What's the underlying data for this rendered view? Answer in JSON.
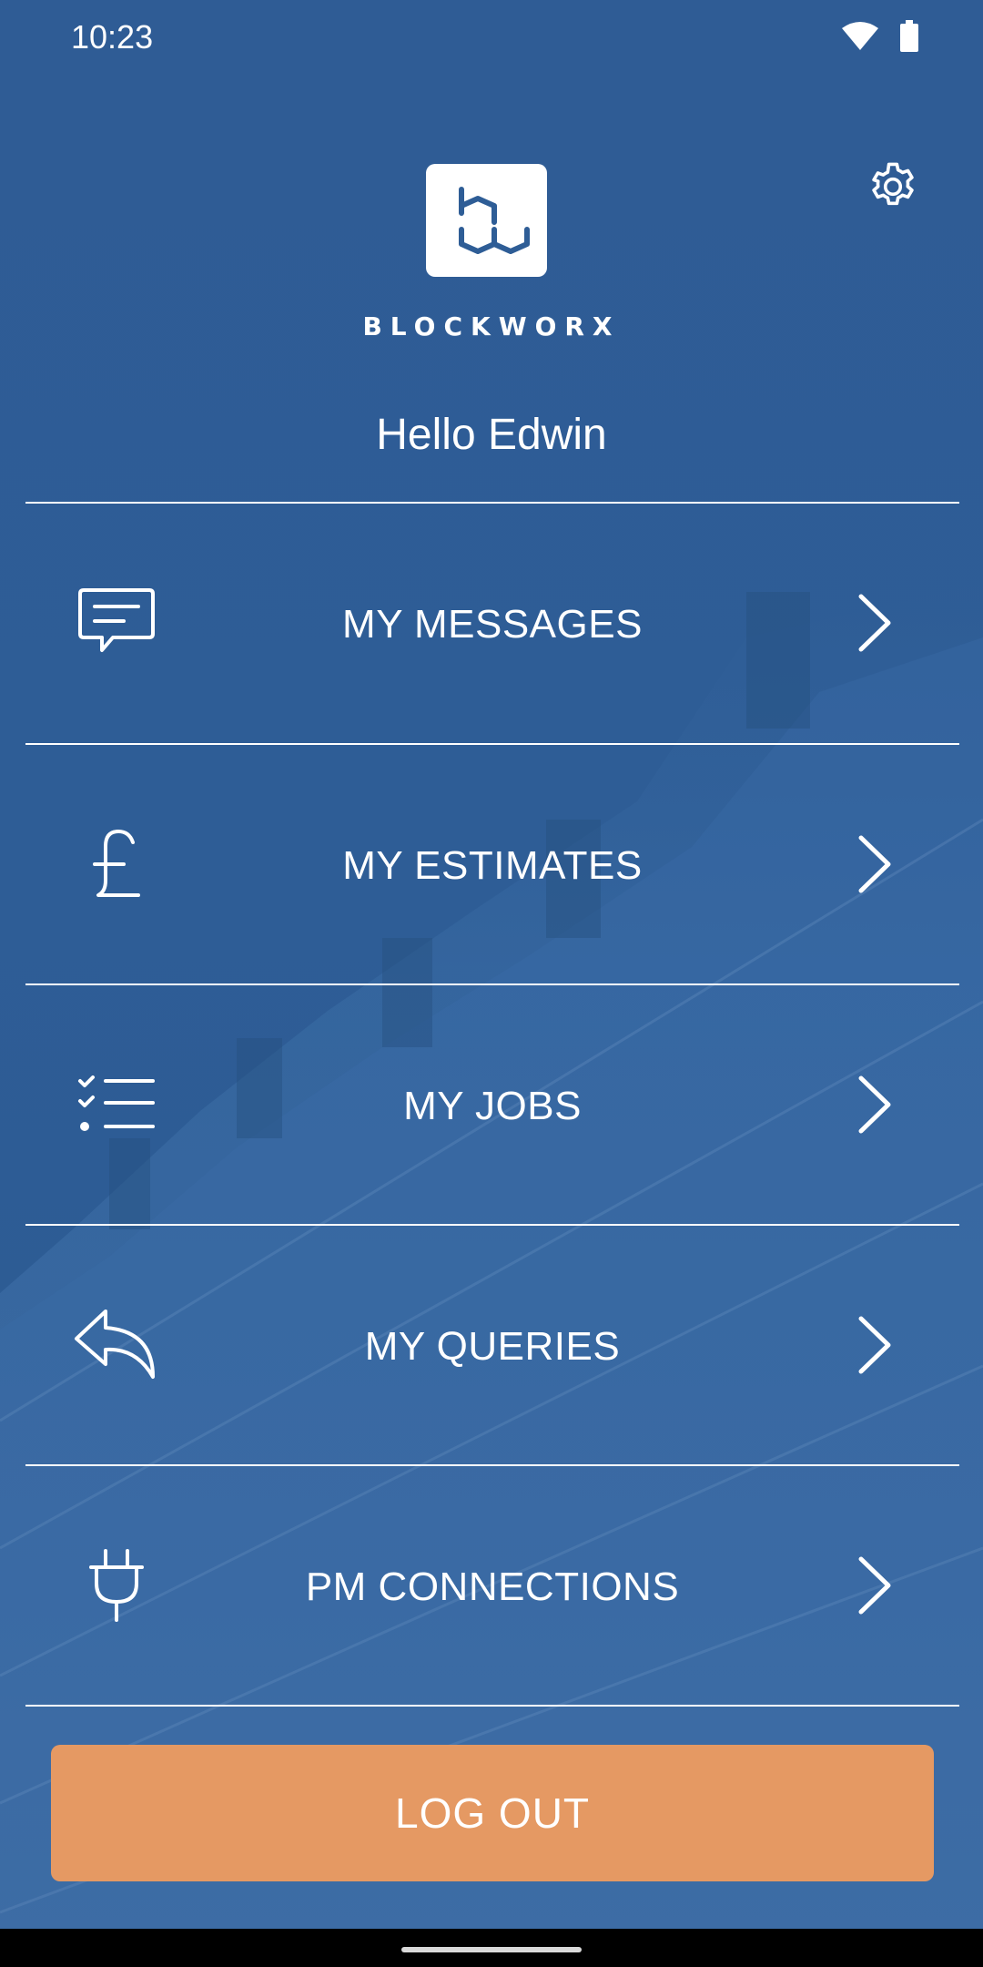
{
  "status_bar": {
    "time": "10:23",
    "icons": [
      "wifi-icon",
      "battery-icon"
    ]
  },
  "header": {
    "brand_name": "BLOCKWORX",
    "greeting": "Hello Edwin",
    "settings_icon": "gear-icon",
    "logo_icon": "blockworx-logo-icon"
  },
  "menu": {
    "items": [
      {
        "label": "MY MESSAGES",
        "icon": "message-icon"
      },
      {
        "label": "MY ESTIMATES",
        "icon": "pound-icon"
      },
      {
        "label": "MY JOBS",
        "icon": "checklist-icon"
      },
      {
        "label": "MY QUERIES",
        "icon": "reply-icon"
      },
      {
        "label": "PM CONNECTIONS",
        "icon": "plug-icon"
      }
    ],
    "chevron_icon": "chevron-right-icon"
  },
  "logout": {
    "label": "LOG OUT"
  },
  "colors": {
    "background": "#2e5d96",
    "accent_button": "#e59963",
    "text": "#ffffff",
    "logo_blue": "#2e5d96"
  }
}
